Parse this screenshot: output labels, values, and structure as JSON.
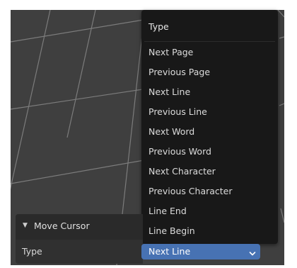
{
  "viewport": {
    "background": "#3f3f3f",
    "grid_color": "#7c7c7c"
  },
  "menu": {
    "title": "Type",
    "items": [
      "Next Page",
      "Previous Page",
      "Next Line",
      "Previous Line",
      "Next Word",
      "Previous Word",
      "Next Character",
      "Previous Character",
      "Line End",
      "Line Begin"
    ]
  },
  "panel": {
    "header": "Move Cursor",
    "type_label": "Type",
    "type_value": "Next Line"
  },
  "colors": {
    "menu_bg": "#181818",
    "panel_bg": "#303030",
    "accent": "#4772b3"
  },
  "icons": {
    "collapse": "triangle-down-icon",
    "dropdown": "chevron-down-icon"
  }
}
